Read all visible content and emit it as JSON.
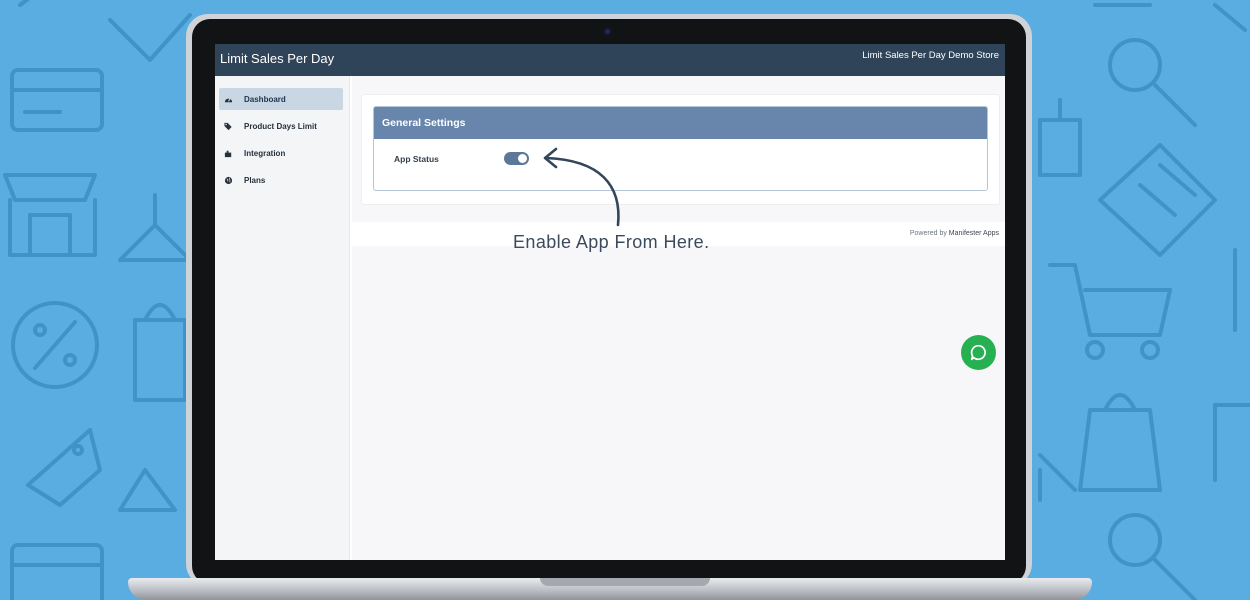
{
  "app": {
    "title": "Limit Sales Per Day",
    "store_name": "Limit Sales Per Day Demo Store"
  },
  "sidebar": {
    "items": [
      {
        "label": "Dashboard",
        "icon": "dashboard-gauge-icon",
        "active": true
      },
      {
        "label": "Product Days Limit",
        "icon": "tags-icon",
        "active": false
      },
      {
        "label": "Integration",
        "icon": "puzzle-icon",
        "active": false
      },
      {
        "label": "Plans",
        "icon": "globe-icon",
        "active": false
      }
    ]
  },
  "settings_panel": {
    "title": "General Settings",
    "app_status_label": "App Status",
    "app_status_enabled": true
  },
  "footer": {
    "powered_by": "Powered by",
    "brand": "Manifester Apps"
  },
  "annotation": {
    "text": "Enable App From Here."
  },
  "chat": {
    "icon": "chat-bubble-icon"
  },
  "colors": {
    "background": "#59ade0",
    "topbar": "#2f4359",
    "panel_header": "#6886ab",
    "toggle_on": "#5b7899",
    "chat_button": "#27b052"
  }
}
